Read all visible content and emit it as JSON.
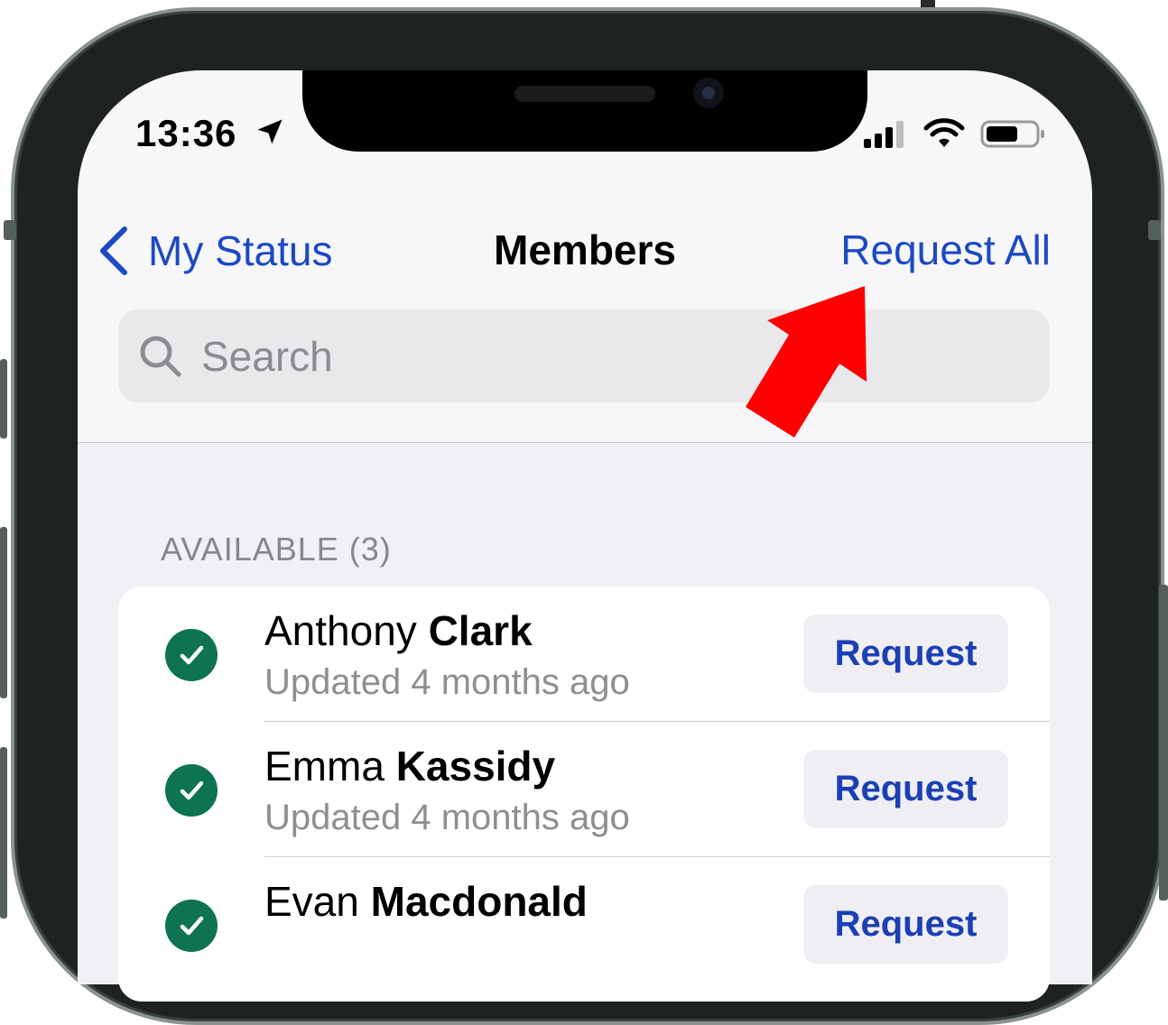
{
  "status_bar": {
    "time": "13:36",
    "location_icon": "location-arrow-icon",
    "signal_icon": "cellular-signal-icon",
    "wifi_icon": "wifi-icon",
    "battery_icon": "battery-icon"
  },
  "nav": {
    "back_icon": "chevron-left-icon",
    "back_label": "My Status",
    "title": "Members",
    "right_action": "Request All"
  },
  "search": {
    "icon": "search-icon",
    "placeholder": "Search"
  },
  "section": {
    "header": "AVAILABLE (3)"
  },
  "members": [
    {
      "first": "Anthony",
      "last": "Clark",
      "updated": "Updated 4 months ago",
      "action": "Request",
      "status_icon": "checkmark-circle-icon"
    },
    {
      "first": "Emma",
      "last": "Kassidy",
      "updated": "Updated 4 months ago",
      "action": "Request",
      "status_icon": "checkmark-circle-icon"
    },
    {
      "first": "Evan",
      "last": "Macdonald",
      "updated": "",
      "action": "Request",
      "status_icon": "checkmark-circle-icon"
    }
  ],
  "annotation": {
    "arrow_icon": "red-arrow-pointer-icon",
    "color": "#ff0000"
  },
  "colors": {
    "accent": "#1c49c4",
    "check_green": "#0d7352"
  }
}
